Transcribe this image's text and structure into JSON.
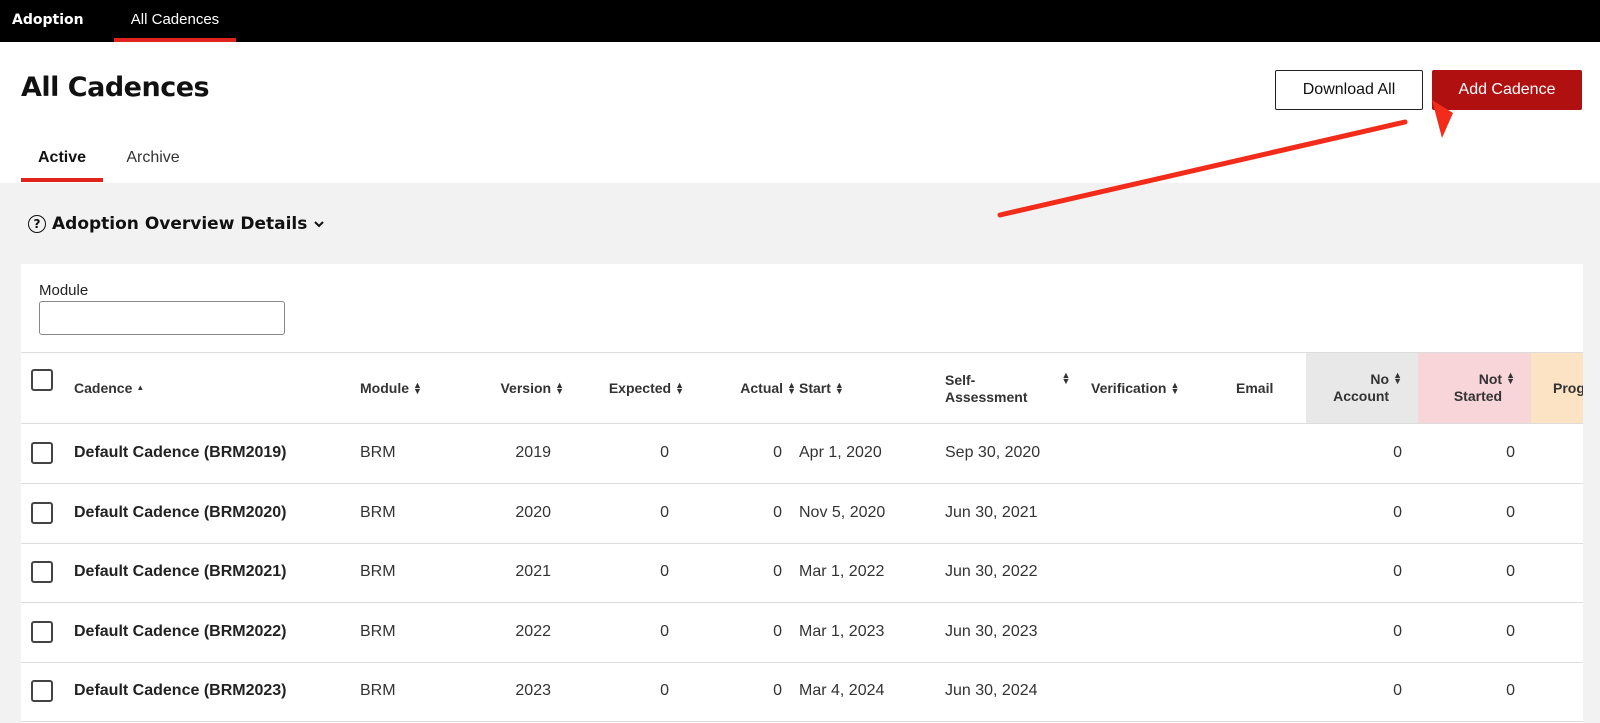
{
  "topbar": {
    "brand": "Adoption",
    "tab": "All Cadences"
  },
  "header": {
    "title": "All Cadences",
    "download_label": "Download All",
    "add_label": "Add Cadence"
  },
  "tabs": {
    "active": "Active",
    "archive": "Archive"
  },
  "overview": {
    "label": "Adoption Overview Details",
    "help_glyph": "?"
  },
  "filter": {
    "module_label": "Module",
    "module_value": ""
  },
  "columns": {
    "cadence": "Cadence",
    "module": "Module",
    "version": "Version",
    "expected": "Expected",
    "actual": "Actual",
    "start": "Start",
    "self_1": "Self-",
    "self_2": "Assessment",
    "verification": "Verification",
    "email": "Email",
    "noacc_1": "No",
    "noacc_2": "Account",
    "notstarted_1": "Not",
    "notstarted_2": "Started",
    "progress": "Prog"
  },
  "rows": [
    {
      "cadence": "Default Cadence (BRM2019)",
      "module": "BRM",
      "version": "2019",
      "expected": "0",
      "actual": "0",
      "start": "Apr 1, 2020",
      "self": "Sep 30, 2020",
      "no_account": "0",
      "not_started": "0"
    },
    {
      "cadence": "Default Cadence (BRM2020)",
      "module": "BRM",
      "version": "2020",
      "expected": "0",
      "actual": "0",
      "start": "Nov 5, 2020",
      "self": "Jun 30, 2021",
      "no_account": "0",
      "not_started": "0"
    },
    {
      "cadence": "Default Cadence (BRM2021)",
      "module": "BRM",
      "version": "2021",
      "expected": "0",
      "actual": "0",
      "start": "Mar 1, 2022",
      "self": "Jun 30, 2022",
      "no_account": "0",
      "not_started": "0"
    },
    {
      "cadence": "Default Cadence (BRM2022)",
      "module": "BRM",
      "version": "2022",
      "expected": "0",
      "actual": "0",
      "start": "Mar 1, 2023",
      "self": "Jun 30, 2023",
      "no_account": "0",
      "not_started": "0"
    },
    {
      "cadence": "Default Cadence (BRM2023)",
      "module": "BRM",
      "version": "2023",
      "expected": "0",
      "actual": "0",
      "start": "Mar 4, 2024",
      "self": "Jun 30, 2024",
      "no_account": "0",
      "not_started": "0"
    }
  ],
  "colors": {
    "accent": "#e0241c",
    "primary_button": "#b01010",
    "arrow": "#f22b1a"
  }
}
